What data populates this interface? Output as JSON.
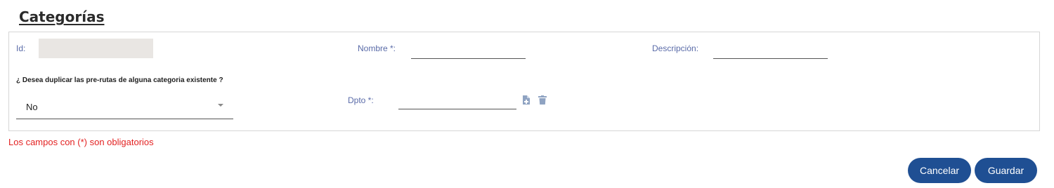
{
  "page": {
    "title": "Categorías"
  },
  "form": {
    "id_label": "Id:",
    "id_value": "",
    "nombre_label": "Nombre *:",
    "nombre_value": "",
    "descripcion_label": "Descripción:",
    "descripcion_value": "",
    "duplicate_question": "¿ Desea duplicar las pre-rutas de alguna categoria existente ?",
    "duplicate_selected": "No",
    "dpto_label": "Dpto *:",
    "dpto_value": ""
  },
  "icons": {
    "add": "file-add-icon",
    "delete": "trash-icon",
    "dropdown": "chevron-down-icon"
  },
  "footer": {
    "required_note": "Los campos con (*) son obligatorios",
    "cancel_label": "Cancelar",
    "save_label": "Guardar"
  },
  "colors": {
    "label": "#5a6ba8",
    "required_note": "#e32222",
    "button": "#1f4f93",
    "id_field": "#e9e6e3"
  }
}
